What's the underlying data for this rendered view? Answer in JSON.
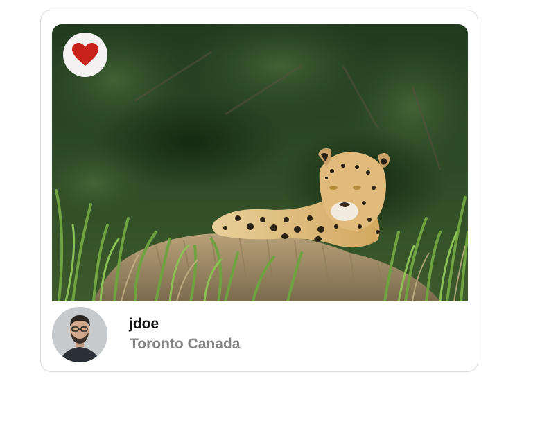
{
  "post": {
    "username": "jdoe",
    "location": "Toronto Canada",
    "liked": true
  },
  "icons": {
    "like": "heart-icon",
    "avatar": "user-avatar-photo"
  },
  "colors": {
    "heart": "#c8221b",
    "card_border": "#d9d9d9",
    "username": "#111111",
    "location": "#858585"
  }
}
